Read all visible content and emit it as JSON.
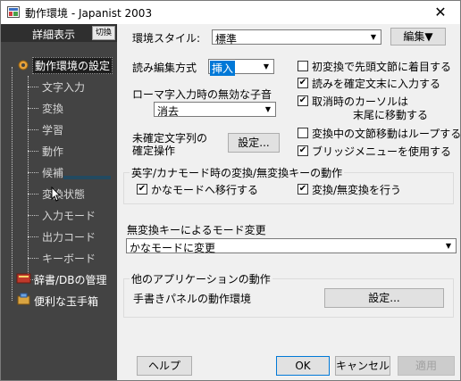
{
  "window": {
    "title": "動作環境 - Japanist 2003",
    "close_glyph": "✕"
  },
  "sidebar": {
    "detail_label": "詳細表示",
    "switch_label": "切換",
    "items": [
      {
        "label": "動作環境の設定"
      },
      {
        "label": "文字入力"
      },
      {
        "label": "変換"
      },
      {
        "label": "学習"
      },
      {
        "label": "動作"
      },
      {
        "label": "候補"
      },
      {
        "label": "変換状態"
      },
      {
        "label": "入力モード"
      },
      {
        "label": "出力コード"
      },
      {
        "label": "キーボード"
      },
      {
        "label": "辞書/DBの管理"
      },
      {
        "label": "便利な玉手箱"
      }
    ]
  },
  "main": {
    "style_label": "環境スタイル:",
    "style_value": "標準",
    "edit_button": "編集▼",
    "read_edit_label": "読み編集方式",
    "read_edit_value": "挿入",
    "romaji_label": "ローマ字入力時の無効な子音",
    "romaji_value": "消去",
    "unconfirmed_label_1": "未確定文字列の",
    "unconfirmed_label_2": "確定操作",
    "settings_button": "設定...",
    "checks": [
      {
        "label": "初変換で先頭文節に着目する",
        "checked": false
      },
      {
        "label": "読みを確定文末に入力する",
        "checked": true
      },
      {
        "label": "取消時のカーソルは",
        "label2": "末尾に移動する",
        "checked": true
      },
      {
        "label": "変換中の文節移動はループする",
        "checked": false
      },
      {
        "label": "ブリッジメニューを使用する",
        "checked": true
      }
    ],
    "kana_group": {
      "title": "英字/カナモード時の変換/無変換キーの動作",
      "check1": {
        "label": "かなモードへ移行する",
        "checked": true
      },
      "check2": {
        "label": "変換/無変換を行う",
        "checked": true
      }
    },
    "muhenkan_label": "無変換キーによるモード変更",
    "muhenkan_value": "かなモードに変更",
    "other_group": {
      "title": "他のアプリケーションの動作",
      "handwriting_label": "手書きパネルの動作環境",
      "settings_button": "設定..."
    }
  },
  "footer": {
    "help": "ヘルプ",
    "ok": "OK",
    "cancel": "キャンセル",
    "apply": "適用"
  }
}
